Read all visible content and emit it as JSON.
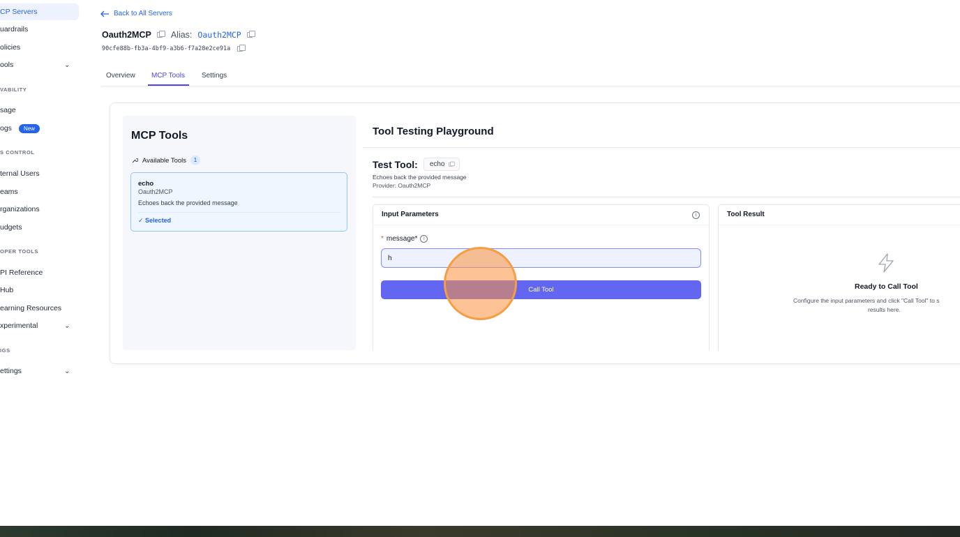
{
  "sidebar": {
    "items": [
      {
        "label": "CP Servers",
        "active": true
      },
      {
        "label": "uardrails"
      },
      {
        "label": "olicies"
      },
      {
        "label": "ools"
      },
      {
        "label": "sage"
      },
      {
        "label": "ogs",
        "badge": "New"
      },
      {
        "label": "ternal Users"
      },
      {
        "label": "eams"
      },
      {
        "label": "rganizations"
      },
      {
        "label": "udgets"
      },
      {
        "label": "PI Reference"
      },
      {
        "label": "Hub"
      },
      {
        "label": "earning Resources"
      },
      {
        "label": "xperimental"
      },
      {
        "label": "ettings"
      }
    ],
    "sections": [
      "VABILITY",
      "S CONTROL",
      "OPER TOOLS",
      "IGS"
    ]
  },
  "header": {
    "back_label": "Back to All Servers",
    "server_name": "Oauth2MCP",
    "alias_label": "Alias:",
    "alias_value": "Oauth2MCP",
    "server_id": "90cfe88b-fb3a-4bf9-a3b6-f7a28e2ce91a"
  },
  "tabs": [
    "Overview",
    "MCP Tools",
    "Settings"
  ],
  "tools_panel": {
    "title": "MCP Tools",
    "available_label": "Available Tools",
    "available_count": "1",
    "tool": {
      "name": "echo",
      "provider": "Oauth2MCP",
      "description": "Echoes back the provided message",
      "status": "Selected"
    }
  },
  "playground": {
    "title": "Tool Testing Playground",
    "test_tool_label": "Test Tool:",
    "tool_name": "echo",
    "description": "Echoes back the provided message",
    "provider_line": "Provider: Oauth2MCP",
    "input_panel_title": "Input Parameters",
    "param_label": "message*",
    "param_value": "h",
    "call_button": "Call Tool",
    "result_panel_title": "Tool Result",
    "ready_title": "Ready to Call Tool",
    "ready_sub_1": "Configure the input parameters and click \"Call Tool\" to s",
    "ready_sub_2": "results here."
  }
}
